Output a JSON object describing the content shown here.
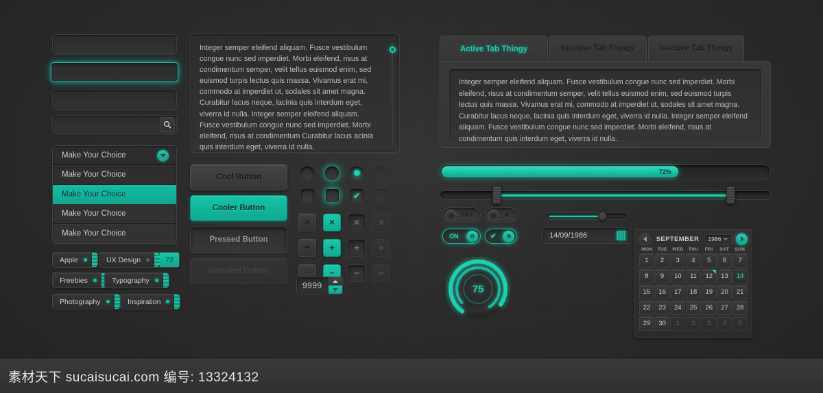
{
  "theme": {
    "accent": "#16c0a3",
    "accent_glow": "#1fd0b0",
    "bg": "#2b2b2b",
    "text": "#c9cccc"
  },
  "inputs": {
    "field_default_value": "",
    "field_focused_value": "",
    "field_disabled_value": "",
    "search_value": "",
    "search_icon": "search-icon"
  },
  "select": {
    "selected_label": "Make Your Choice",
    "arrow_icon": "chevron-down-icon",
    "options": [
      {
        "label": "Make Your Choice",
        "state": "normal"
      },
      {
        "label": "Make Your Choice",
        "state": "selected"
      },
      {
        "label": "Make Your Choice",
        "state": "normal"
      },
      {
        "label": "Make Your Choice",
        "state": "normal"
      }
    ]
  },
  "tags": [
    {
      "label": "Apple",
      "count": ""
    },
    {
      "label": "UX Design",
      "count": "72"
    },
    {
      "label": "Freebies",
      "count": ""
    },
    {
      "label": "Typography",
      "count": ""
    },
    {
      "label": "Photography",
      "count": ""
    },
    {
      "label": "Inspiration",
      "count": ""
    }
  ],
  "textarea": {
    "value": "Integer semper eleifend aliquam. Fusce vestibulum congue nunc sed imperdiet. Morbi eleifend, risus at condimentum semper, velit tellus euismod enim, sed euismod turpis lectus quis massa. Vivamus erat mi, commodo at imperdiet ut, sodales sit amet magna. Curabitur lacus neque, lacinia quis interdum eget, viverra id nulla. Integer semper eleifend aliquam. Fusce vestibulum congue nunc sed imperdiet. Morbi eleifend, risus at condimentum Curabitur lacus acinia quis interdum eget, viverra id nulla.",
    "scrollbar_name": "textarea-scrollbar"
  },
  "buttons": {
    "normal": "Cool Button",
    "primary": "Cooler Button",
    "pressed": "Pressed Button",
    "disabled": "Disabled Button"
  },
  "control_grid": {
    "column_states": [
      "normal",
      "focused",
      "checked",
      "disabled"
    ],
    "icons": {
      "close": "×",
      "plus": "+",
      "minus": "−",
      "check": "✔"
    }
  },
  "stepper": {
    "value": "9999",
    "up_icon": "caret-up-icon",
    "down_icon": "caret-down-icon"
  },
  "tabs": [
    {
      "label": "Active Tab Thingy",
      "active": true
    },
    {
      "label": "Inactive Tab Thingy",
      "active": false
    },
    {
      "label": "Inactive Tab Thingy",
      "active": false
    }
  ],
  "tab_panel": {
    "content": "Integer semper eleifend aliquam. Fusce vestibulum congue nunc sed imperdiet. Morbi eleifend, risus at condimentum semper, velit tellus euismod enim, sed euismod turpis lectus quis massa. Vivamus erat mi, commodo at imperdiet ut, sodales sit amet magna. Curabitur lacus neque, lacinia quis interdum eget, viverra id nulla. Integer semper eleifend aliquam. Fusce vestibulum congue nunc sed imperdiet. Morbi eleifend, risus at condimentum quis interdum eget, viverra id nulla."
  },
  "progress": {
    "label": "72%",
    "percent": 72
  },
  "range_slider": {
    "low_percent": 17,
    "high_percent": 88
  },
  "small_slider": {
    "percent": 70
  },
  "toggles": {
    "switch_off_label": "OFF",
    "switch_close_icon": "×",
    "switch_on_label": "ON",
    "switch_check_icon": "✔"
  },
  "date_field": {
    "value": "14/09/1986",
    "icon": "calendar-icon"
  },
  "gauge": {
    "value": "75",
    "percent": 75
  },
  "calendar": {
    "month": "SEPTEMBER",
    "year": "1986",
    "prev_icon": "caret-left-icon",
    "next_icon": "caret-right-icon",
    "weekdays": [
      "MON",
      "TUE",
      "WED",
      "THU",
      "FRI",
      "SAT",
      "SUN"
    ],
    "weeks": [
      [
        {
          "d": "1"
        },
        {
          "d": "2"
        },
        {
          "d": "3"
        },
        {
          "d": "4"
        },
        {
          "d": "5"
        },
        {
          "d": "6"
        },
        {
          "d": "7"
        }
      ],
      [
        {
          "d": "8"
        },
        {
          "d": "9"
        },
        {
          "d": "10"
        },
        {
          "d": "11"
        },
        {
          "d": "12",
          "mark": true
        },
        {
          "d": "13"
        },
        {
          "d": "14",
          "selected": true
        }
      ],
      [
        {
          "d": "15"
        },
        {
          "d": "16"
        },
        {
          "d": "17"
        },
        {
          "d": "18"
        },
        {
          "d": "19"
        },
        {
          "d": "20"
        },
        {
          "d": "21"
        }
      ],
      [
        {
          "d": "22"
        },
        {
          "d": "23"
        },
        {
          "d": "24"
        },
        {
          "d": "25"
        },
        {
          "d": "26"
        },
        {
          "d": "27"
        },
        {
          "d": "28"
        }
      ],
      [
        {
          "d": "29"
        },
        {
          "d": "30"
        },
        {
          "d": "1",
          "muted": true
        },
        {
          "d": "2",
          "muted": true
        },
        {
          "d": "3",
          "muted": true
        },
        {
          "d": "4",
          "muted": true
        },
        {
          "d": "5",
          "muted": true
        }
      ]
    ]
  },
  "watermark": {
    "text": "素材天下 sucaisucai.com  编号: 13324132"
  }
}
